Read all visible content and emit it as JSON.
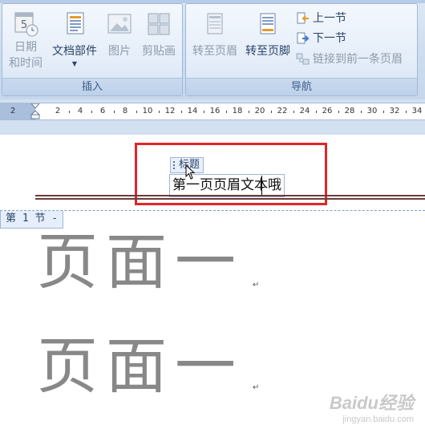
{
  "ribbon": {
    "insert_group": {
      "label": "插入",
      "date_time": {
        "line1": "日期",
        "line2": "和时间",
        "icon": "calendar-clock-icon"
      },
      "quick_parts": {
        "label": "文档部件",
        "icon": "quick-parts-icon"
      },
      "picture": {
        "label": "图片",
        "icon": "picture-icon"
      },
      "clip_art": {
        "label": "剪贴画",
        "icon": "clip-art-icon"
      }
    },
    "navigation_group": {
      "label": "导航",
      "goto_header": {
        "label": "转至页眉",
        "icon": "goto-header-icon"
      },
      "goto_footer": {
        "label": "转至页脚",
        "icon": "goto-footer-icon"
      },
      "previous_section": {
        "label": "上一节",
        "icon": "previous-section-icon"
      },
      "next_section": {
        "label": "下一节",
        "icon": "next-section-icon"
      },
      "link_to_previous": {
        "label": "链接到前一条页眉",
        "icon": "link-to-previous-icon"
      }
    }
  },
  "ruler": {
    "left_label": "2",
    "ticks": [
      "2",
      "4",
      "6",
      "8",
      "10",
      "12",
      "14",
      "16",
      "18",
      "20",
      "22",
      "24",
      "26",
      "28",
      "30",
      "32",
      "34"
    ]
  },
  "document": {
    "title_control_label": "标题",
    "header_text": "第一页页眉文本哦",
    "section_tab": "第 1 节 -",
    "body_lines": [
      "页面一",
      "页面一"
    ],
    "paragraph_mark": "↵"
  },
  "watermark": {
    "line1": "Baidu经验",
    "line2": "jingyan.baidu.com"
  },
  "colors": {
    "highlight_box": "#e2252b",
    "ribbon_text": "#2b4467",
    "body_text": "#888888"
  }
}
